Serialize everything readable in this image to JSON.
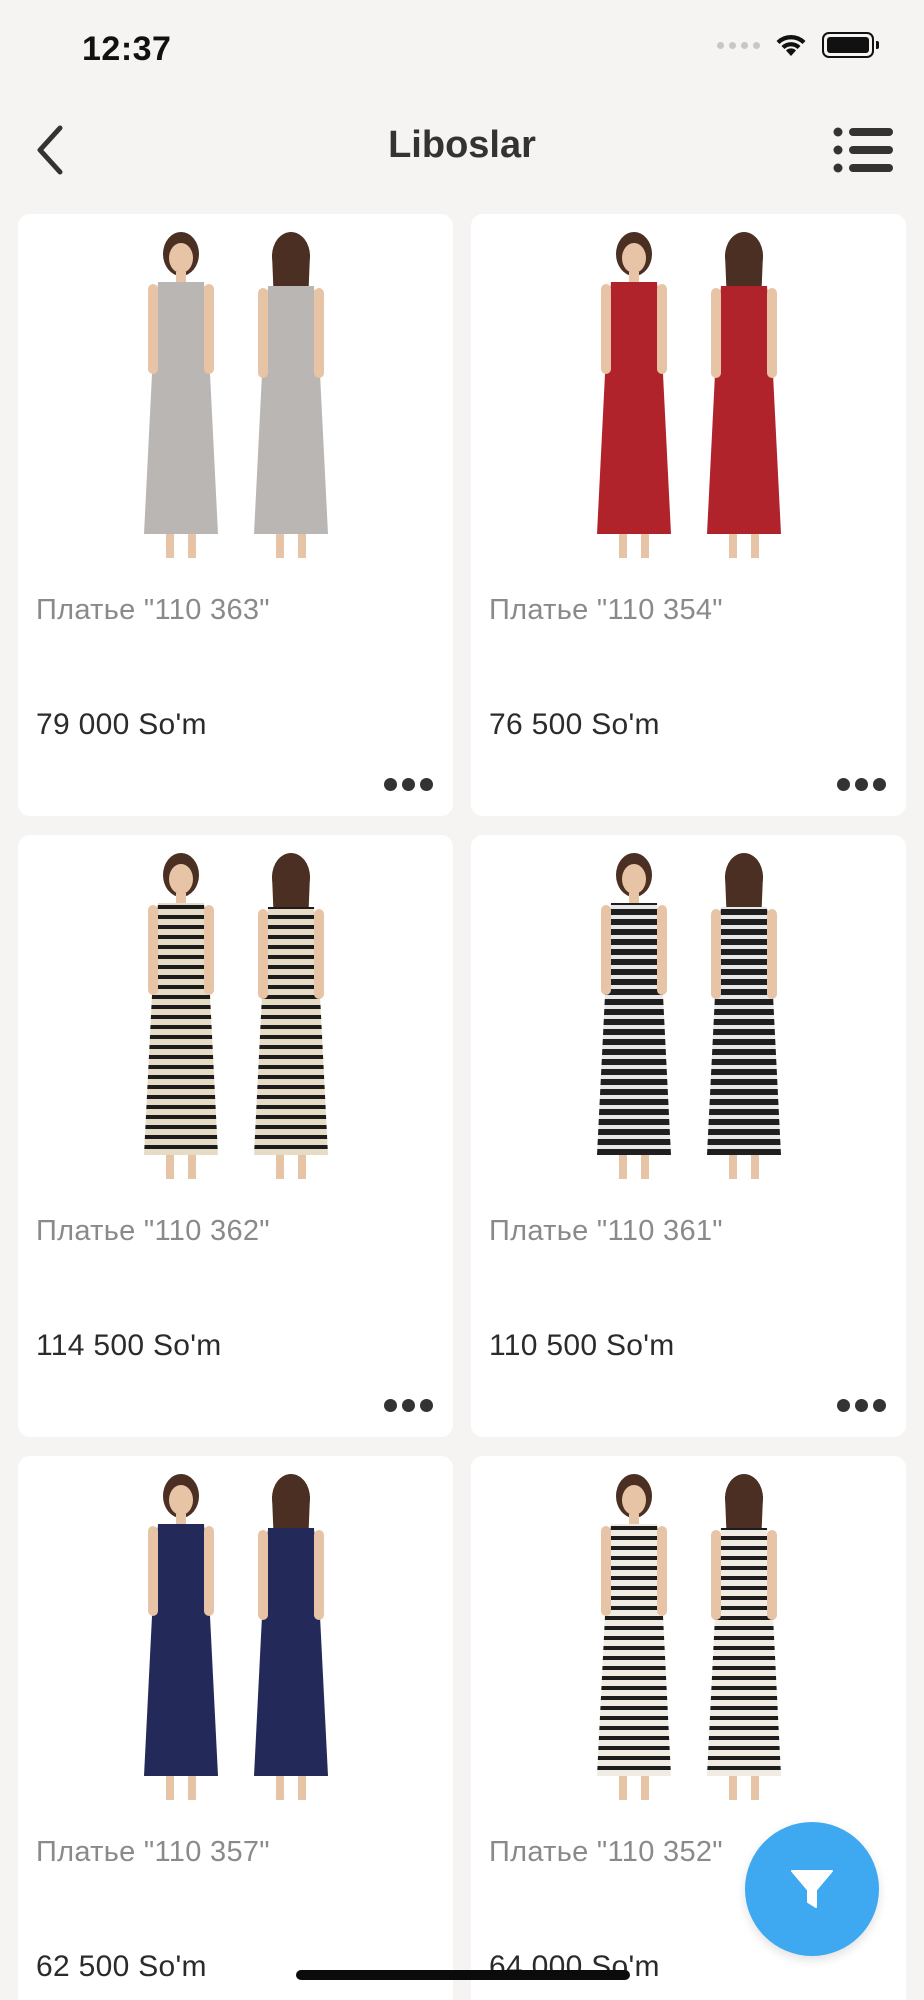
{
  "status_bar": {
    "time": "12:37"
  },
  "nav": {
    "title": "Liboslar"
  },
  "products": [
    {
      "title": "Платье \"110 363\"",
      "price": "79 000 So'm",
      "dress_color": "#b9b6b3",
      "pattern": "solid"
    },
    {
      "title": "Платье \"110 354\"",
      "price": "76 500 So'm",
      "dress_color": "#b0232b",
      "pattern": "solid"
    },
    {
      "title": "Платье \"110 362\"",
      "price": "114 500 So'm",
      "dress_color": "#e6dcc6",
      "pattern": "stripes-dark"
    },
    {
      "title": "Платье \"110 361\"",
      "price": "110 500 So'm",
      "dress_color": "#1f1f1f",
      "pattern": "stripes-light"
    },
    {
      "title": "Платье \"110 357\"",
      "price": "62 500 So'm",
      "dress_color": "#232a5a",
      "pattern": "solid"
    },
    {
      "title": "Платье \"110 352\"",
      "price": "64 000 So'm",
      "dress_color": "#f0ece4",
      "pattern": "stripes-dark"
    }
  ],
  "colors": {
    "accent": "#3ea8f0",
    "background": "#f5f4f2"
  }
}
